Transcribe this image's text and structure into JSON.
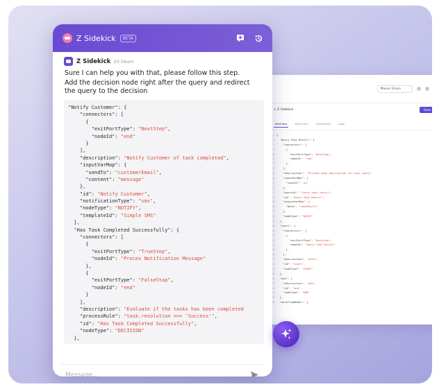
{
  "chat": {
    "title": "Z Sidekick",
    "badge": "BETA",
    "message": {
      "sender": "Z Sidekick",
      "time": "10:56am",
      "lines": [
        "Sure I can help you with that, please follow this step.",
        "Add the decision node right after the query and redirect the query to the decision"
      ]
    },
    "code_lines": [
      [
        [
          "\"Notify Customer\": {",
          0
        ]
      ],
      [
        [
          "    \"connectors\": [",
          0
        ]
      ],
      [
        [
          "      {",
          0
        ]
      ],
      [
        [
          "        \"exitPortType\": ",
          0
        ],
        [
          "\"NextStep\"",
          1
        ],
        [
          ",",
          0
        ]
      ],
      [
        [
          "        \"nodeId\": ",
          0
        ],
        [
          "\"end\"",
          1
        ]
      ],
      [
        [
          "      }",
          0
        ]
      ],
      [
        [
          "    ],",
          0
        ]
      ],
      [
        [
          "    \"description\": ",
          0
        ],
        [
          "\"Notify Customer of task completed\"",
          1
        ],
        [
          ",",
          0
        ]
      ],
      [
        [
          "    \"inputVarMap\": {",
          0
        ]
      ],
      [
        [
          "      \"sendTo\": ",
          0
        ],
        [
          "\"customerEmail\"",
          1
        ],
        [
          ",",
          0
        ]
      ],
      [
        [
          "      \"content\": ",
          0
        ],
        [
          "\"message\"",
          1
        ]
      ],
      [
        [
          "    },",
          0
        ]
      ],
      [
        [
          "    \"id\": ",
          0
        ],
        [
          "\"Notify Customer\"",
          1
        ],
        [
          ",",
          0
        ]
      ],
      [
        [
          "    \"notificationType\": ",
          0
        ],
        [
          "\"sms\"",
          1
        ],
        [
          ",",
          0
        ]
      ],
      [
        [
          "    \"nodeType\": ",
          0
        ],
        [
          "\"NOTIFY\"",
          1
        ],
        [
          ",",
          0
        ]
      ],
      [
        [
          "    \"templateId\": ",
          0
        ],
        [
          "\"Simple SMS\"",
          1
        ]
      ],
      [
        [
          "  },",
          0
        ]
      ],
      [
        [
          "  \"Has Task Completed Successfully\": {",
          0
        ]
      ],
      [
        [
          "    \"connectors\": [",
          0
        ]
      ],
      [
        [
          "      {",
          0
        ]
      ],
      [
        [
          "        \"exitPortType\": ",
          0
        ],
        [
          "\"TrueStep\"",
          1
        ],
        [
          ",",
          0
        ]
      ],
      [
        [
          "        \"nodeId\": ",
          0
        ],
        [
          "\"Proces Notification Message\"",
          1
        ]
      ],
      [
        [
          "      },",
          0
        ]
      ],
      [
        [
          "      {",
          0
        ]
      ],
      [
        [
          "        \"exitPortType\": ",
          0
        ],
        [
          "\"FalseStap\"",
          1
        ],
        [
          ",",
          0
        ]
      ],
      [
        [
          "        \"nodeId\": ",
          0
        ],
        [
          "\"end\"",
          1
        ]
      ],
      [
        [
          "      }",
          0
        ]
      ],
      [
        [
          "    ],",
          0
        ]
      ],
      [
        [
          "    \"description\": ",
          0
        ],
        [
          "\"Evaluate if the tasks has been completed",
          1
        ]
      ],
      [
        [
          "    \"processRule\": ",
          0
        ],
        [
          "\"task.resolution === 'Success'\"",
          1
        ],
        [
          ",",
          0
        ]
      ],
      [
        [
          "    \"id\": ",
          0
        ],
        [
          "\"Has Task Completed Successfully\"",
          1
        ],
        [
          ",",
          0
        ]
      ],
      [
        [
          "    \"nodeType\": ",
          0
        ],
        [
          "\"DECISION\"",
          1
        ]
      ],
      [
        [
          "  },",
          0
        ]
      ]
    ],
    "composer": {
      "placeholder": "Message..."
    }
  },
  "editor": {
    "user_label": "Mason Grace",
    "back_label": "< Z Sidekick",
    "save_label": "Save",
    "tabs": [
      {
        "label": "Workflow",
        "active": true
      },
      {
        "label": "Input Vars",
        "active": false
      },
      {
        "label": "Connectors",
        "active": false
      },
      {
        "label": "Logs",
        "active": false
      }
    ],
    "code_lines": [
      [
        [
          "{",
          0
        ]
      ],
      [
        [
          "  \"Query Task Result\": {",
          0
        ]
      ],
      [
        [
          "    \"connectors\": [",
          0
        ]
      ],
      [
        [
          "      {",
          0
        ]
      ],
      [
        [
          "        \"exitPortType\": ",
          0
        ],
        [
          "\"NextStep\"",
          1
        ],
        [
          ",",
          0
        ]
      ],
      [
        [
          "        \"nodeId\": ",
          0
        ],
        [
          "\"end\"",
          1
        ]
      ],
      [
        [
          "      }",
          0
        ]
      ],
      [
        [
          "    ],",
          0
        ]
      ],
      [
        [
          "    \"description\": ",
          0
        ],
        [
          "\"Provide some description for your query\"",
          1
        ]
      ],
      [
        [
          "    \"inputVarMap\": {",
          0
        ]
      ],
      [
        [
          "      \"taskId\": ",
          0
        ],
        [
          "\"id\"",
          1
        ]
      ],
      [
        [
          "    },",
          0
        ]
      ],
      [
        [
          "    \"queryId\": ",
          0
        ],
        [
          "\"fetch task result\"",
          1
        ],
        [
          ",",
          0
        ]
      ],
      [
        [
          "    \"id\": ",
          0
        ],
        [
          "\"Query Task Result\"",
          1
        ],
        [
          ",",
          0
        ]
      ],
      [
        [
          "    \"outputVarMap\": {",
          0
        ]
      ],
      [
        [
          "      \"data\": ",
          0
        ],
        [
          "\"taskResult\"",
          1
        ]
      ],
      [
        [
          "    },",
          0
        ]
      ],
      [
        [
          "    \"nodeType\": ",
          0
        ],
        [
          "\"QUERY\"",
          1
        ]
      ],
      [
        [
          "  },",
          0
        ]
      ],
      [
        [
          "  \"start\": {",
          0
        ]
      ],
      [
        [
          "    \"connectors\": [",
          0
        ]
      ],
      [
        [
          "      {",
          0
        ]
      ],
      [
        [
          "        \"exitPortType\": ",
          0
        ],
        [
          "\"NextStep\"",
          1
        ],
        [
          ",",
          0
        ]
      ],
      [
        [
          "        \"nodeId\": ",
          0
        ],
        [
          "\"Query Task Result\"",
          1
        ]
      ],
      [
        [
          "      }",
          0
        ]
      ],
      [
        [
          "    ],",
          0
        ]
      ],
      [
        [
          "    \"description\": ",
          0
        ],
        [
          "\"Start\"",
          1
        ],
        [
          ",",
          0
        ]
      ],
      [
        [
          "    \"id\": ",
          0
        ],
        [
          "\"start\"",
          1
        ],
        [
          ",",
          0
        ]
      ],
      [
        [
          "    \"nodeType\": ",
          0
        ],
        [
          "\"START\"",
          1
        ]
      ],
      [
        [
          "  },",
          0
        ]
      ],
      [
        [
          "  \"end\": {",
          0
        ]
      ],
      [
        [
          "    \"description\": ",
          0
        ],
        [
          "\"End\"",
          1
        ],
        [
          ",",
          0
        ]
      ],
      [
        [
          "    \"id\": ",
          0
        ],
        [
          "\"end\"",
          1
        ],
        [
          ",",
          0
        ]
      ],
      [
        [
          "    \"nodeType\": ",
          0
        ],
        [
          "\"END\"",
          1
        ]
      ],
      [
        [
          "  },",
          0
        ]
      ],
      [
        [
          "  \"workflowNodes\": {",
          0
        ]
      ]
    ]
  },
  "icons": {
    "logo": "sidekick-logo-icon",
    "new_chat": "new-chat-icon",
    "history": "history-icon",
    "send": "send-icon",
    "sparkle": "sparkle-icon"
  },
  "colors": {
    "header": "#6a4ad2",
    "accent": "#5b4dd4",
    "string": "#d94b3a",
    "fab": "#5b33c8"
  }
}
